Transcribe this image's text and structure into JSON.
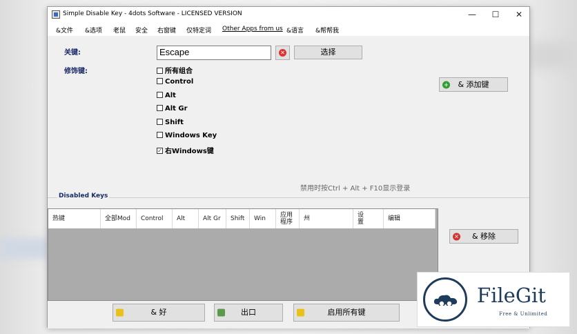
{
  "window": {
    "title": "Simple Disable Key - 4dots Software - LICENSED VERSION",
    "minimize": "—",
    "maximize": "☐",
    "close": "✕"
  },
  "menu": [
    "&文件",
    "&选项",
    "老鼠",
    "安全",
    "右窗键",
    "仅特定词",
    "Other Apps from us",
    "&语言",
    "&帮帮我"
  ],
  "form": {
    "key_label": "关键:",
    "key_value": "Escape",
    "select_button": "选择",
    "modifier_label": "修饰键:",
    "add_key_button": "& 添加键",
    "modifiers": [
      {
        "label": "所有组合",
        "checked": false
      },
      {
        "label": "Control",
        "checked": false
      },
      {
        "label": "Alt",
        "checked": false
      },
      {
        "label": "Alt Gr",
        "checked": false
      },
      {
        "label": "Shift",
        "checked": false
      },
      {
        "label": "Windows Key",
        "checked": false
      },
      {
        "label": "右Windows键",
        "checked": true
      }
    ],
    "hint": "禁用时按Ctrl + Alt + F10显示登录"
  },
  "disabled_keys": {
    "group_label": "Disabled Keys",
    "columns": [
      "热键",
      "全部Mod",
      "Control",
      "Alt",
      "Alt Gr",
      "Shift",
      "Win",
      "应用\n程序",
      "州",
      "设\n置",
      "编辑"
    ],
    "remove_button": "& 移除"
  },
  "bottom": {
    "ok_button": "& 好",
    "exit_button": "出口",
    "enable_all_button": "启用所有键"
  },
  "watermark": {
    "name": "FileGit",
    "tagline": "Free & Unlimited"
  },
  "colors": {
    "label": "#1a2a66",
    "red": "#d33333",
    "green": "#2f9e2f",
    "yellow": "#e8c21a",
    "brand": "#1f3b5c"
  }
}
